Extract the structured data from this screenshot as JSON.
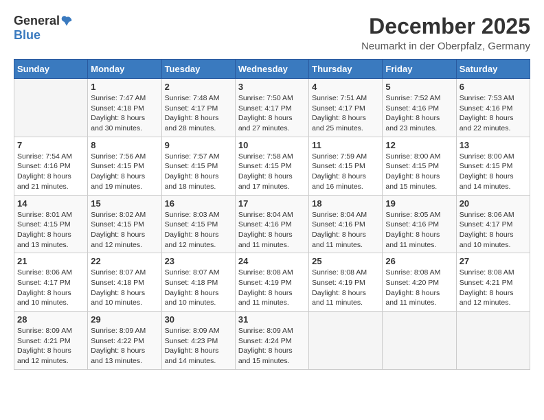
{
  "logo": {
    "general": "General",
    "blue": "Blue"
  },
  "title": "December 2025",
  "subtitle": "Neumarkt in der Oberpfalz, Germany",
  "weekdays": [
    "Sunday",
    "Monday",
    "Tuesday",
    "Wednesday",
    "Thursday",
    "Friday",
    "Saturday"
  ],
  "weeks": [
    [
      {
        "day": "",
        "info": ""
      },
      {
        "day": "1",
        "info": "Sunrise: 7:47 AM\nSunset: 4:18 PM\nDaylight: 8 hours\nand 30 minutes."
      },
      {
        "day": "2",
        "info": "Sunrise: 7:48 AM\nSunset: 4:17 PM\nDaylight: 8 hours\nand 28 minutes."
      },
      {
        "day": "3",
        "info": "Sunrise: 7:50 AM\nSunset: 4:17 PM\nDaylight: 8 hours\nand 27 minutes."
      },
      {
        "day": "4",
        "info": "Sunrise: 7:51 AM\nSunset: 4:17 PM\nDaylight: 8 hours\nand 25 minutes."
      },
      {
        "day": "5",
        "info": "Sunrise: 7:52 AM\nSunset: 4:16 PM\nDaylight: 8 hours\nand 23 minutes."
      },
      {
        "day": "6",
        "info": "Sunrise: 7:53 AM\nSunset: 4:16 PM\nDaylight: 8 hours\nand 22 minutes."
      }
    ],
    [
      {
        "day": "7",
        "info": "Sunrise: 7:54 AM\nSunset: 4:16 PM\nDaylight: 8 hours\nand 21 minutes."
      },
      {
        "day": "8",
        "info": "Sunrise: 7:56 AM\nSunset: 4:15 PM\nDaylight: 8 hours\nand 19 minutes."
      },
      {
        "day": "9",
        "info": "Sunrise: 7:57 AM\nSunset: 4:15 PM\nDaylight: 8 hours\nand 18 minutes."
      },
      {
        "day": "10",
        "info": "Sunrise: 7:58 AM\nSunset: 4:15 PM\nDaylight: 8 hours\nand 17 minutes."
      },
      {
        "day": "11",
        "info": "Sunrise: 7:59 AM\nSunset: 4:15 PM\nDaylight: 8 hours\nand 16 minutes."
      },
      {
        "day": "12",
        "info": "Sunrise: 8:00 AM\nSunset: 4:15 PM\nDaylight: 8 hours\nand 15 minutes."
      },
      {
        "day": "13",
        "info": "Sunrise: 8:00 AM\nSunset: 4:15 PM\nDaylight: 8 hours\nand 14 minutes."
      }
    ],
    [
      {
        "day": "14",
        "info": "Sunrise: 8:01 AM\nSunset: 4:15 PM\nDaylight: 8 hours\nand 13 minutes."
      },
      {
        "day": "15",
        "info": "Sunrise: 8:02 AM\nSunset: 4:15 PM\nDaylight: 8 hours\nand 12 minutes."
      },
      {
        "day": "16",
        "info": "Sunrise: 8:03 AM\nSunset: 4:15 PM\nDaylight: 8 hours\nand 12 minutes."
      },
      {
        "day": "17",
        "info": "Sunrise: 8:04 AM\nSunset: 4:16 PM\nDaylight: 8 hours\nand 11 minutes."
      },
      {
        "day": "18",
        "info": "Sunrise: 8:04 AM\nSunset: 4:16 PM\nDaylight: 8 hours\nand 11 minutes."
      },
      {
        "day": "19",
        "info": "Sunrise: 8:05 AM\nSunset: 4:16 PM\nDaylight: 8 hours\nand 11 minutes."
      },
      {
        "day": "20",
        "info": "Sunrise: 8:06 AM\nSunset: 4:17 PM\nDaylight: 8 hours\nand 10 minutes."
      }
    ],
    [
      {
        "day": "21",
        "info": "Sunrise: 8:06 AM\nSunset: 4:17 PM\nDaylight: 8 hours\nand 10 minutes."
      },
      {
        "day": "22",
        "info": "Sunrise: 8:07 AM\nSunset: 4:18 PM\nDaylight: 8 hours\nand 10 minutes."
      },
      {
        "day": "23",
        "info": "Sunrise: 8:07 AM\nSunset: 4:18 PM\nDaylight: 8 hours\nand 10 minutes."
      },
      {
        "day": "24",
        "info": "Sunrise: 8:08 AM\nSunset: 4:19 PM\nDaylight: 8 hours\nand 11 minutes."
      },
      {
        "day": "25",
        "info": "Sunrise: 8:08 AM\nSunset: 4:19 PM\nDaylight: 8 hours\nand 11 minutes."
      },
      {
        "day": "26",
        "info": "Sunrise: 8:08 AM\nSunset: 4:20 PM\nDaylight: 8 hours\nand 11 minutes."
      },
      {
        "day": "27",
        "info": "Sunrise: 8:08 AM\nSunset: 4:21 PM\nDaylight: 8 hours\nand 12 minutes."
      }
    ],
    [
      {
        "day": "28",
        "info": "Sunrise: 8:09 AM\nSunset: 4:21 PM\nDaylight: 8 hours\nand 12 minutes."
      },
      {
        "day": "29",
        "info": "Sunrise: 8:09 AM\nSunset: 4:22 PM\nDaylight: 8 hours\nand 13 minutes."
      },
      {
        "day": "30",
        "info": "Sunrise: 8:09 AM\nSunset: 4:23 PM\nDaylight: 8 hours\nand 14 minutes."
      },
      {
        "day": "31",
        "info": "Sunrise: 8:09 AM\nSunset: 4:24 PM\nDaylight: 8 hours\nand 15 minutes."
      },
      {
        "day": "",
        "info": ""
      },
      {
        "day": "",
        "info": ""
      },
      {
        "day": "",
        "info": ""
      }
    ]
  ]
}
